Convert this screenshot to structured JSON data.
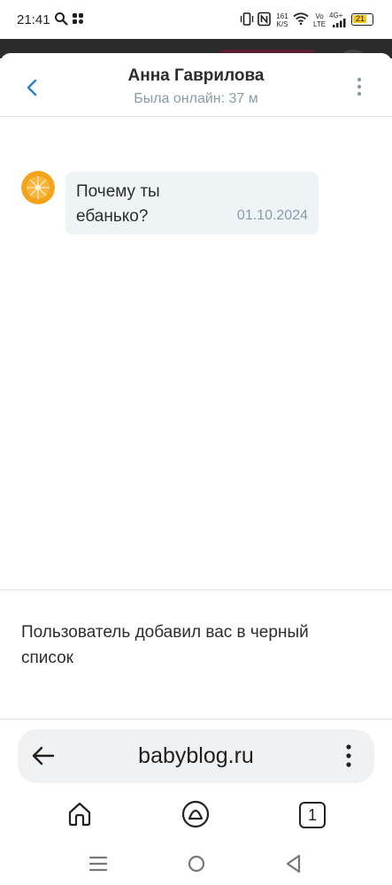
{
  "status_bar": {
    "time": "21:41",
    "net_speed_top": "161",
    "net_speed_bottom": "K/S",
    "volte_top": "Vo",
    "volte_bottom": "LTE",
    "signal_label": "4G+",
    "battery": "21",
    "battery_color": "#f5c518"
  },
  "chat": {
    "title": "Анна Гаврилова",
    "subtitle": "Была онлайн: 37 м"
  },
  "message": {
    "text": "Почему ты ебанько?",
    "date": "01.10.2024"
  },
  "block_notice": "Пользователь добавил вас в черный список",
  "browser": {
    "url": "babyblog.ru",
    "tabs_count": "1"
  },
  "colors": {
    "accent": "#2a7fc4",
    "muted": "#8a9ba8",
    "bubble": "#eef3f6",
    "avatar": "#f6a21a"
  }
}
